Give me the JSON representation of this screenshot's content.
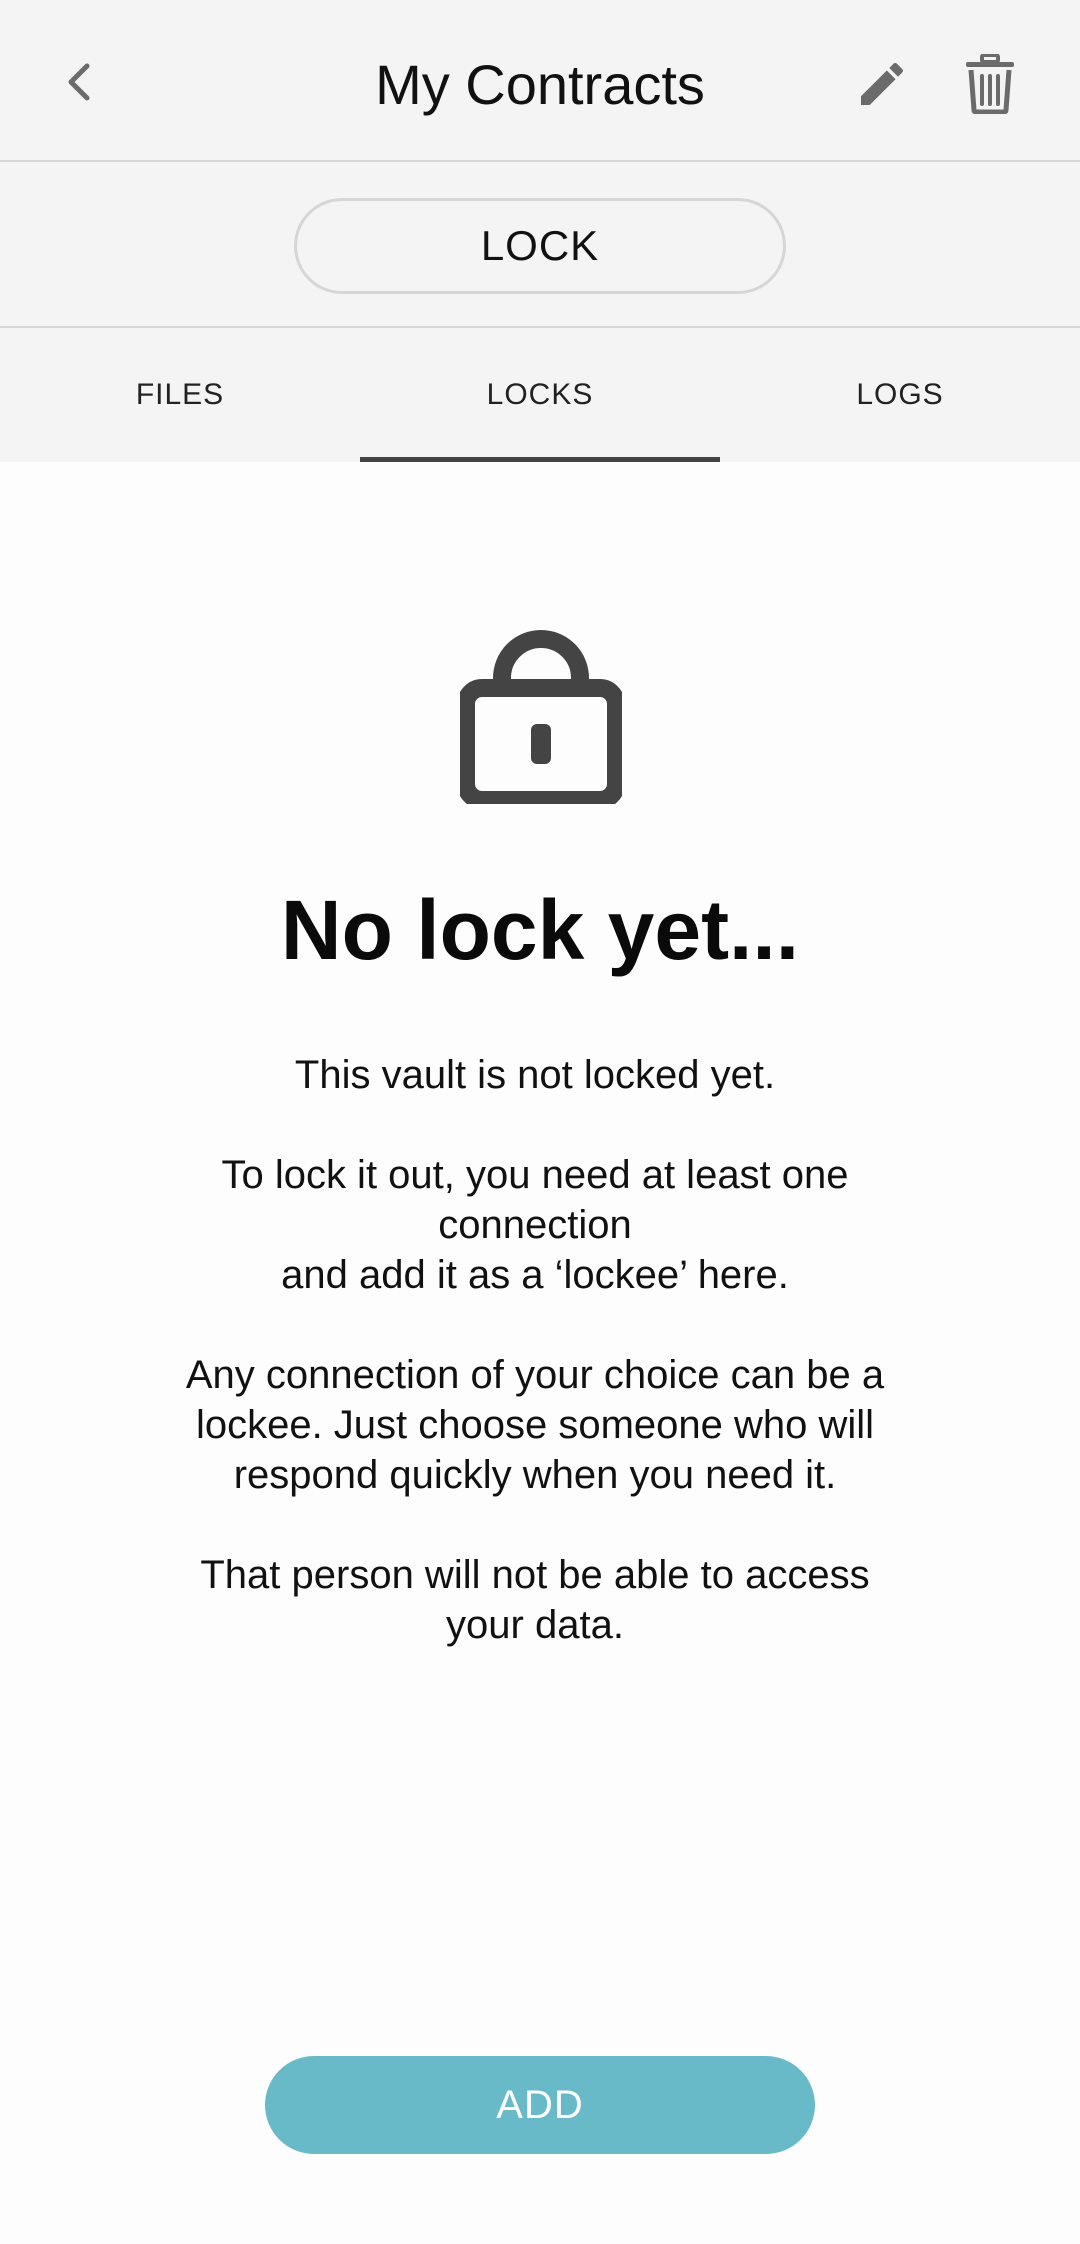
{
  "header": {
    "title": "My Contracts",
    "back_icon": "chevron-left-icon",
    "edit_icon": "pencil-icon",
    "delete_icon": "trash-icon"
  },
  "lock_button": {
    "label": "LOCK"
  },
  "tabs": [
    {
      "label": "FILES",
      "selected": false
    },
    {
      "label": "LOCKS",
      "selected": true
    },
    {
      "label": "LOGS",
      "selected": false
    }
  ],
  "empty_state": {
    "icon": "padlock-icon",
    "title": "No lock yet...",
    "paragraphs": [
      [
        "This vault is not locked yet."
      ],
      [
        "To lock it out, you need at least one",
        "connection",
        "and add it as a ‘lockee’ here."
      ],
      [
        "Any connection of your choice can be a",
        "lockee. Just choose someone who will",
        "respond quickly when you need it."
      ],
      [
        "That person will not be able to access",
        "your data."
      ]
    ]
  },
  "add_button": {
    "label": "ADD"
  },
  "colors": {
    "header_bg": "#f4f4f4",
    "accent": "#69bac9",
    "icon": "#6b6b6b",
    "tab_indicator": "#444444"
  }
}
